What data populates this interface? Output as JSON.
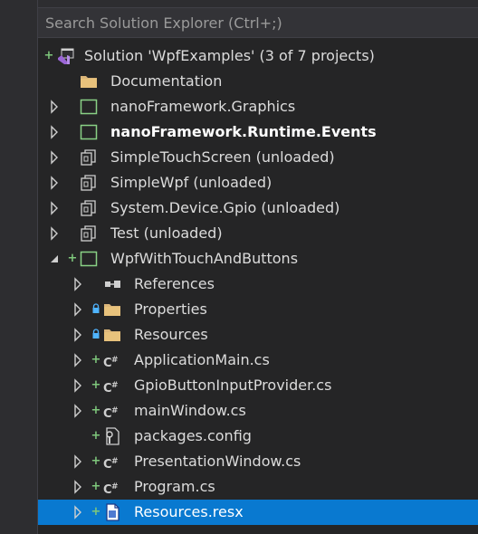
{
  "search": {
    "placeholder": "Search Solution Explorer (Ctrl+;)"
  },
  "tree": [
    {
      "label": "Solution 'WpfExamples' (3 of 7 projects)",
      "icon": "visual-studio-solution-icon",
      "status": "plus",
      "expander": "none",
      "level": 0,
      "bold": false
    },
    {
      "label": "Documentation",
      "icon": "folder-icon",
      "status": "",
      "expander": "none",
      "level": 1,
      "bold": false
    },
    {
      "label": "nanoFramework.Graphics",
      "icon": "project-icon",
      "status": "",
      "expander": "collapsed",
      "level": 1,
      "bold": false
    },
    {
      "label": "nanoFramework.Runtime.Events",
      "icon": "project-icon",
      "status": "",
      "expander": "collapsed",
      "level": 1,
      "bold": true
    },
    {
      "label": "SimpleTouchScreen (unloaded)",
      "icon": "unloaded-project-icon",
      "status": "",
      "expander": "collapsed",
      "level": 1,
      "bold": false
    },
    {
      "label": "SimpleWpf (unloaded)",
      "icon": "unloaded-project-icon",
      "status": "",
      "expander": "collapsed",
      "level": 1,
      "bold": false
    },
    {
      "label": "System.Device.Gpio (unloaded)",
      "icon": "unloaded-project-icon",
      "status": "",
      "expander": "collapsed",
      "level": 1,
      "bold": false
    },
    {
      "label": "Test (unloaded)",
      "icon": "unloaded-project-icon",
      "status": "",
      "expander": "collapsed",
      "level": 1,
      "bold": false
    },
    {
      "label": "WpfWithTouchAndButtons",
      "icon": "project-icon",
      "status": "plus",
      "expander": "expanded",
      "level": 1,
      "bold": false
    },
    {
      "label": "References",
      "icon": "references-icon",
      "status": "",
      "expander": "collapsed",
      "level": 2,
      "bold": false
    },
    {
      "label": "Properties",
      "icon": "folder-icon",
      "status": "lock",
      "expander": "collapsed",
      "level": 2,
      "bold": false
    },
    {
      "label": "Resources",
      "icon": "folder-icon",
      "status": "lock",
      "expander": "collapsed",
      "level": 2,
      "bold": false
    },
    {
      "label": "ApplicationMain.cs",
      "icon": "csharp-file-icon",
      "status": "plus",
      "expander": "collapsed",
      "level": 2,
      "bold": false
    },
    {
      "label": "GpioButtonInputProvider.cs",
      "icon": "csharp-file-icon",
      "status": "plus",
      "expander": "collapsed",
      "level": 2,
      "bold": false
    },
    {
      "label": "mainWindow.cs",
      "icon": "csharp-file-icon",
      "status": "plus",
      "expander": "collapsed",
      "level": 2,
      "bold": false
    },
    {
      "label": "packages.config",
      "icon": "config-file-icon",
      "status": "plus",
      "expander": "none",
      "level": 2,
      "bold": false
    },
    {
      "label": "PresentationWindow.cs",
      "icon": "csharp-file-icon",
      "status": "plus",
      "expander": "collapsed",
      "level": 2,
      "bold": false
    },
    {
      "label": "Program.cs",
      "icon": "csharp-file-icon",
      "status": "plus",
      "expander": "collapsed",
      "level": 2,
      "bold": false
    },
    {
      "label": "Resources.resx",
      "icon": "resx-file-icon",
      "status": "plus",
      "expander": "collapsed",
      "level": 2,
      "bold": false,
      "selected": true
    }
  ]
}
